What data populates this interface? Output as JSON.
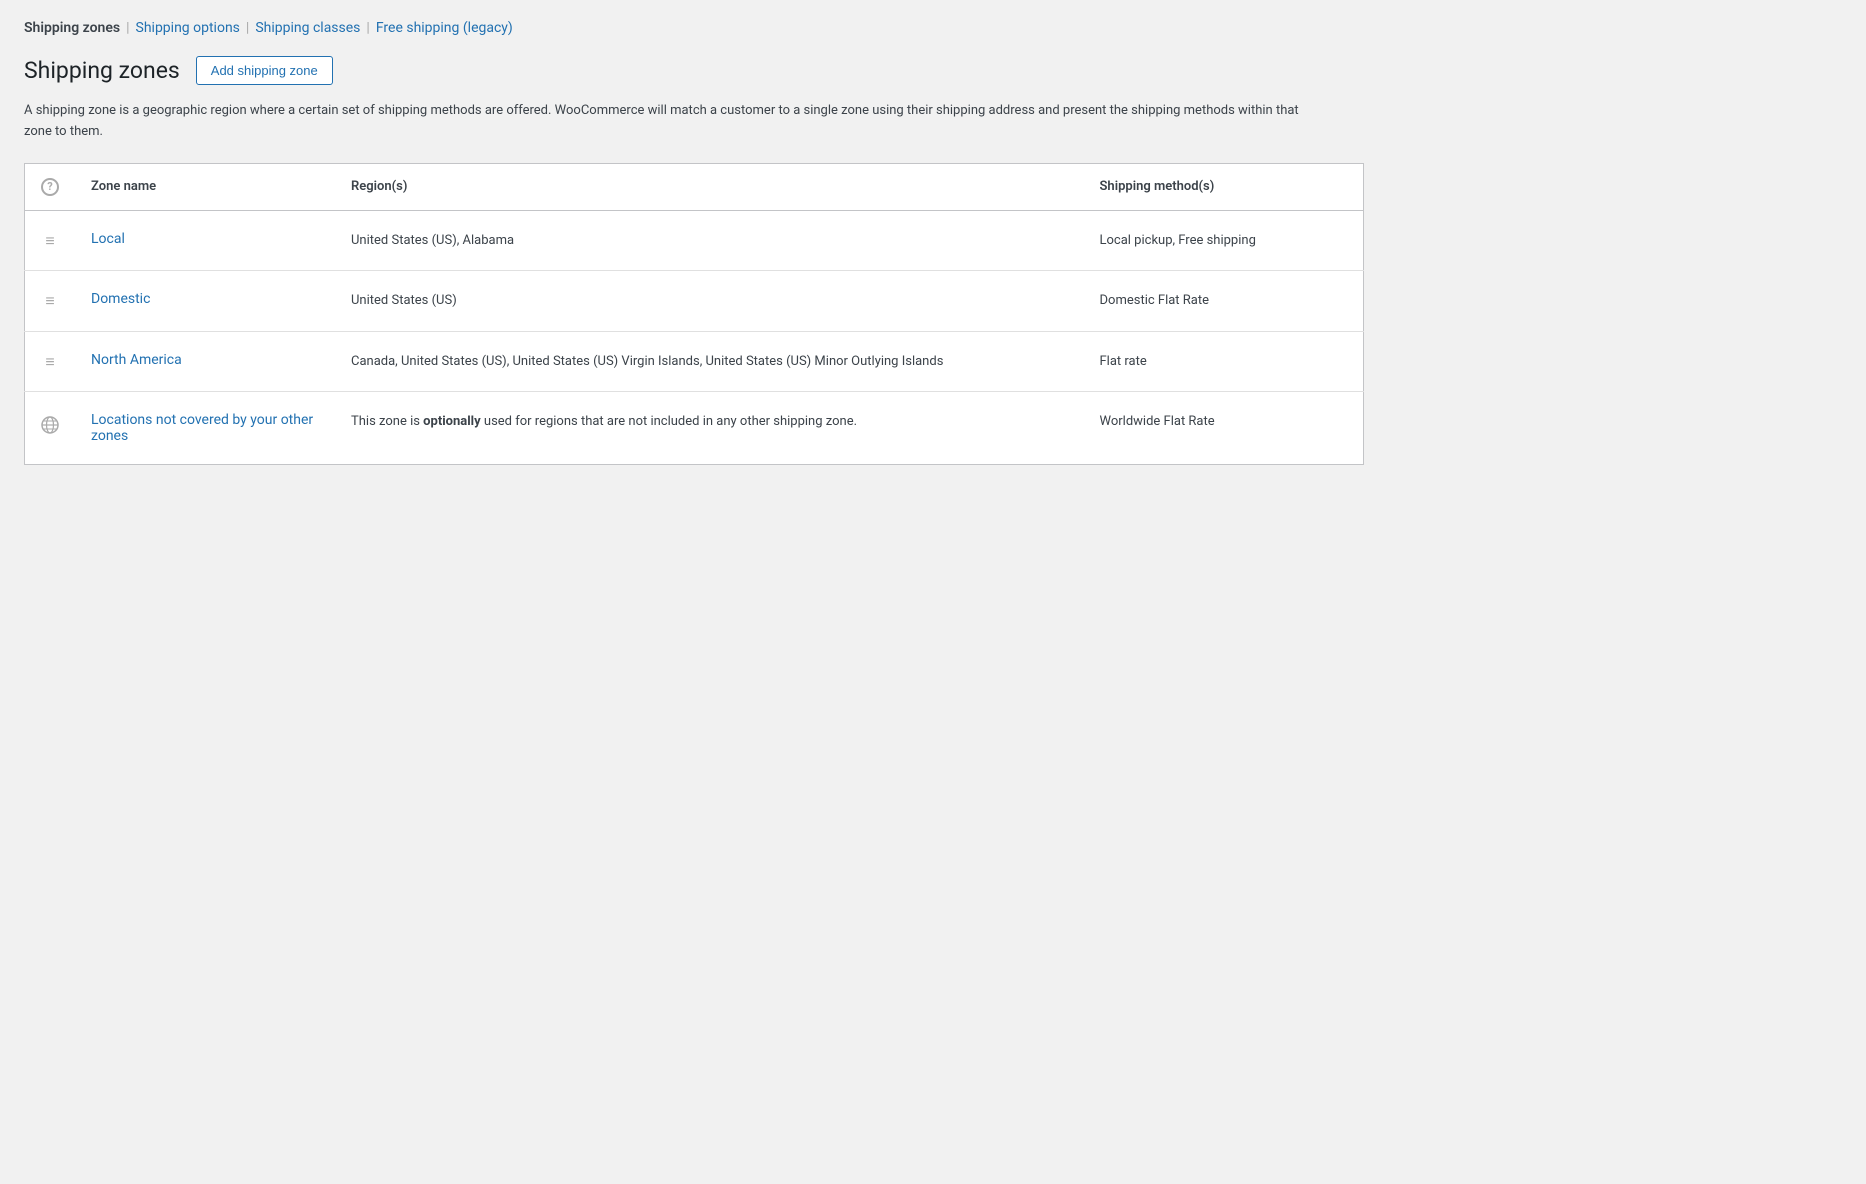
{
  "nav": {
    "current": "Shipping zones",
    "links": [
      {
        "label": "Shipping options",
        "id": "shipping-options"
      },
      {
        "label": "Shipping classes",
        "id": "shipping-classes"
      },
      {
        "label": "Free shipping (legacy)",
        "id": "free-shipping-legacy"
      }
    ],
    "separator": "|"
  },
  "header": {
    "title": "Shipping zones",
    "add_button_label": "Add shipping zone"
  },
  "description": "A shipping zone is a geographic region where a certain set of shipping methods are offered. WooCommerce will match a customer to a single zone using their shipping address and present the shipping methods within that zone to them.",
  "table": {
    "columns": [
      "",
      "Zone name",
      "Region(s)",
      "Shipping method(s)"
    ],
    "rows": [
      {
        "id": "local",
        "icon_type": "drag",
        "zone_name": "Local",
        "regions": "United States (US), Alabama",
        "shipping_methods": "Local pickup, Free shipping"
      },
      {
        "id": "domestic",
        "icon_type": "drag",
        "zone_name": "Domestic",
        "regions": "United States (US)",
        "shipping_methods": "Domestic Flat Rate"
      },
      {
        "id": "north-america",
        "icon_type": "drag",
        "zone_name": "North America",
        "regions": "Canada, United States (US), United States (US) Virgin Islands, United States (US) Minor Outlying Islands",
        "shipping_methods": "Flat rate"
      },
      {
        "id": "locations-not-covered",
        "icon_type": "globe",
        "zone_name": "Locations not covered by your other zones",
        "regions_html": "This zone is <strong>optionally</strong> used for regions that are not included in any other shipping zone.",
        "regions_plain": "This zone is optionally used for regions that are not included in any other shipping zone.",
        "optionally_word": "optionally",
        "shipping_methods": "Worldwide Flat Rate"
      }
    ]
  }
}
